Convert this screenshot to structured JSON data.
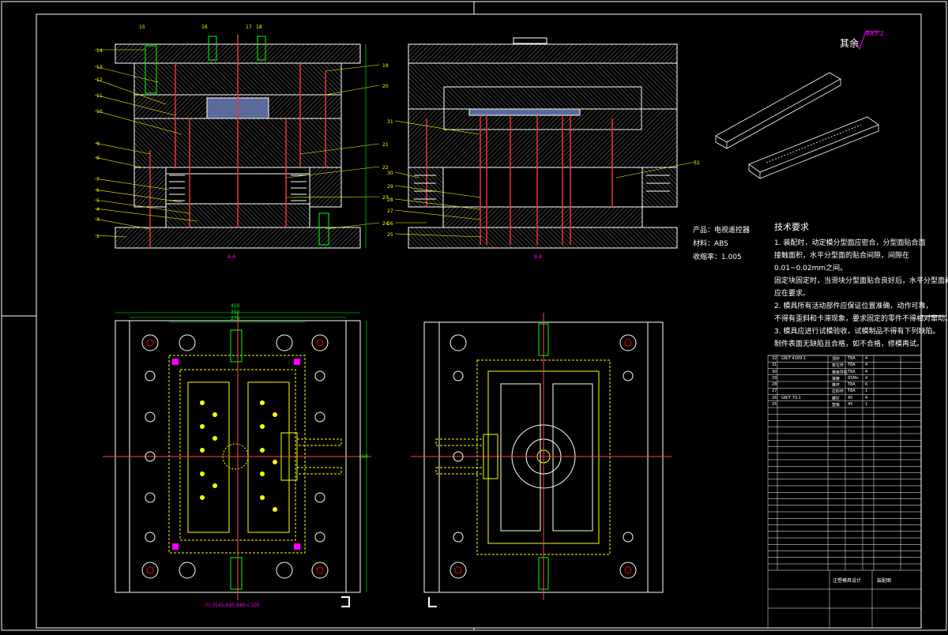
{
  "drawing": {
    "surface_roughness": {
      "label": "其余",
      "value": "Ra3.2"
    },
    "product_info": {
      "product": "产品：电视遥控器",
      "material": "材料：ABS",
      "shrinkage": "收缩率：1.005"
    },
    "tech_requirements": {
      "title": "技术要求",
      "lines": [
        "1. 装配时，动定模分型面应密合，分型面贴合面",
        "接触面积，水平分型面的贴合间隙，间隙在",
        "0.01~0.02mm之间。",
        "固定块固定时，当滑块分型面贴合良好后，水平分型面间隙",
        "应在要求。",
        "2. 模具所有活动部件应保证位置准确，动作可靠，",
        "不得有歪斜和卡滞现象，要求固定的零件不得相对窜动。",
        "3. 模具应进行试模验收，试模制品不得有下列缺陷。",
        "制件表面无缺陷且合格，如不合格，修模再试。"
      ]
    },
    "section_labels": [
      "A-A",
      "B-B"
    ],
    "dimensions": [
      "450",
      "390",
      "270",
      "450"
    ],
    "bottom_note": "CI-3545-A90-B80-C100",
    "title_block": {
      "drawing_name": "注塑模具设计",
      "scale_label": "装配图"
    },
    "part_numbers_left": [
      "14",
      "13",
      "12",
      "11",
      "10",
      "9",
      "8",
      "7",
      "6",
      "5",
      "4",
      "3",
      "2",
      "1"
    ],
    "part_numbers_top": [
      "15",
      "16",
      "17",
      "18"
    ],
    "part_numbers_right": [
      "19",
      "20",
      "21",
      "22",
      "23",
      "24"
    ],
    "part_numbers_b": [
      "31",
      "30",
      "29",
      "28",
      "27",
      "26",
      "25",
      "32"
    ],
    "bom": [
      {
        "no": "32",
        "name": "顶杆",
        "mat": "T8A",
        "qty": "4",
        "std": "GB/T 4169.1"
      },
      {
        "no": "31",
        "name": "复位杆",
        "mat": "T8A",
        "qty": "4",
        "std": ""
      },
      {
        "no": "30",
        "name": "推板导柱",
        "mat": "T8A",
        "qty": "4",
        "std": ""
      },
      {
        "no": "29",
        "name": "弹簧",
        "mat": "65Mn",
        "qty": "4",
        "std": ""
      },
      {
        "no": "28",
        "name": "推杆",
        "mat": "T8A",
        "qty": "6",
        "std": ""
      },
      {
        "no": "27",
        "name": "拉料杆",
        "mat": "T8A",
        "qty": "1",
        "std": ""
      },
      {
        "no": "26",
        "name": "螺钉",
        "mat": "45",
        "qty": "4",
        "std": "GB/T 70.1"
      },
      {
        "no": "25",
        "name": "垫板",
        "mat": "45",
        "qty": "1",
        "std": ""
      }
    ]
  }
}
